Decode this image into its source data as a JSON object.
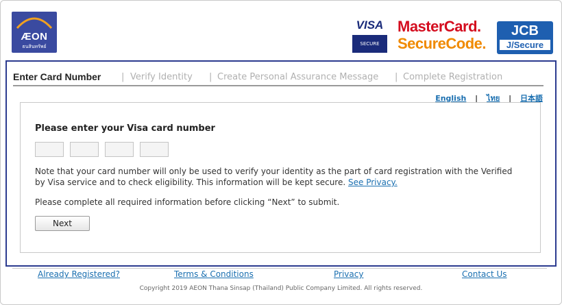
{
  "header": {
    "aeon_logo": {
      "word": "ÆON",
      "sub": "ธนสินทรัพย์"
    },
    "visa_logo": {
      "word": "VISA",
      "sub": "SECURE"
    },
    "mastercard_logo": {
      "line1": "MasterCard.",
      "line2": "SecureCode."
    },
    "jcb_logo": {
      "word": "JCB",
      "sub": "J/Secure"
    }
  },
  "steps": [
    {
      "label": "Enter Card Number",
      "active": true
    },
    {
      "label": "Verify Identity",
      "active": false
    },
    {
      "label": "Create Personal Assurance Message",
      "active": false
    },
    {
      "label": "Complete Registration",
      "active": false
    }
  ],
  "step_separator": "|",
  "languages": [
    {
      "label": "English"
    },
    {
      "label": "ไทย"
    },
    {
      "label": "日本語"
    }
  ],
  "language_separator": "|",
  "form": {
    "title": "Please enter your Visa card number",
    "card_inputs": [
      "",
      "",
      "",
      ""
    ],
    "note_text": "Note that your card number will only be used to verify your identity as the part of card registration with the Verified by Visa service and to check eligibility. This information will be kept secure.",
    "note_link": "See Privacy.",
    "instruction": "Please complete all required information before clicking “Next” to submit.",
    "next_button": "Next"
  },
  "footer": {
    "links": {
      "already_registered": "Already Registered?",
      "terms": "Terms & Conditions",
      "privacy": "Privacy",
      "contact": "Contact Us"
    },
    "copyright": "Copyright 2019 AEON Thana Sinsap (Thailand) Public Company Limited. All rights reserved."
  },
  "colors": {
    "panel_border": "#2b3a8f",
    "link": "#1a6fb0",
    "inactive_step": "#b0b0b0",
    "aeon_brand": "#3a4aa0",
    "mastercard_red": "#d40d1f",
    "mastercard_orange": "#f08a00",
    "jcb_blue": "#1e5fb0"
  }
}
